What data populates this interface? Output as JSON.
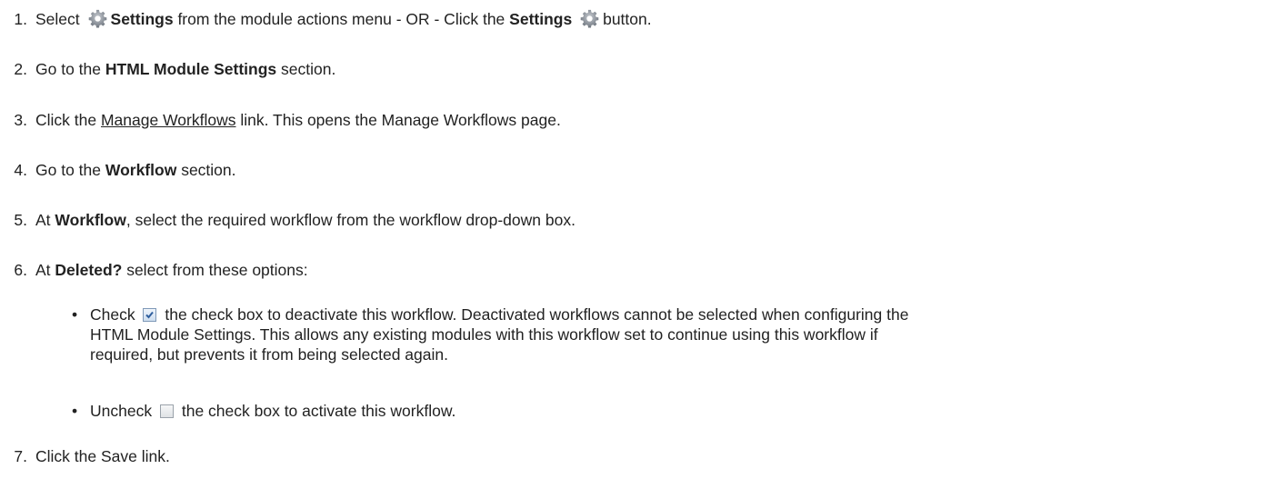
{
  "steps": [
    {
      "number": "1.",
      "a": "Select",
      "b": "Settings",
      "c": "from the module actions menu - OR - Click the",
      "d": "Settings",
      "e": "button."
    },
    {
      "number": "2.",
      "a": "Go to the",
      "b": "HTML Module Settings",
      "c": "section."
    },
    {
      "number": "3.",
      "a": "Click the",
      "link": "Manage Workflows",
      "c": "link. This opens the Manage Workflows page."
    },
    {
      "number": "4.",
      "a": "Go to the",
      "b": "Workflow",
      "c": "section."
    },
    {
      "number": "5.",
      "a": "At",
      "b": "Workflow",
      "c": ", select the required workflow from the workflow drop-down box."
    },
    {
      "number": "6.",
      "a": "At",
      "b": "Deleted?",
      "c": "select from these options:"
    },
    {
      "number": "7.",
      "a": "Click the Save link."
    }
  ],
  "options": [
    {
      "a": "Check",
      "b": "the check box to deactivate this workflow. Deactivated workflows cannot be selected when configuring the",
      "c": "HTML Module Settings. This allows any existing modules with this workflow set to continue using this workflow if",
      "d": "required, but prevents it from being selected again."
    },
    {
      "a": "Uncheck",
      "b": "the check box to activate this workflow."
    }
  ],
  "icons": {
    "gear": "gear-icon",
    "checked": "checkbox-checked-icon",
    "unchecked": "checkbox-unchecked-icon"
  },
  "colors": {
    "text": "#222222",
    "gear": "#8a9099"
  }
}
